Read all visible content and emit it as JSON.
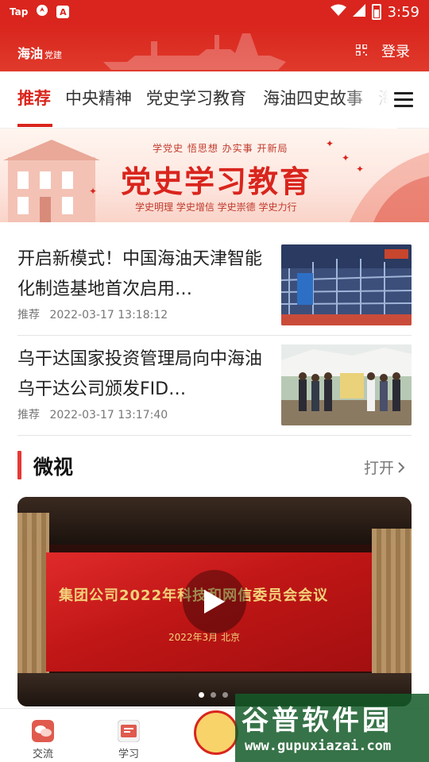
{
  "status_bar": {
    "app_label": "Tap",
    "time": "3:59",
    "icons": [
      "tap-app-icon",
      "navigation-icon",
      "text-icon",
      "wifi-icon",
      "signal-icon",
      "battery-icon"
    ]
  },
  "header": {
    "logo_text": "海油",
    "logo_sub": "党建",
    "login_label": "登录",
    "colors": {
      "primary": "#d9251d"
    }
  },
  "tabs": [
    {
      "label": "推荐",
      "active": true
    },
    {
      "label": "中央精神",
      "active": false
    },
    {
      "label": "党史学习教育",
      "active": false
    },
    {
      "label": "海油四史故事",
      "active": false
    },
    {
      "label": "海",
      "active": false
    }
  ],
  "banner": {
    "top_text": "学党史 悟思想 办实事 开新局",
    "title": "党史学习教育",
    "sub_text": "学史明理 学史增信 学史崇德 学史力行"
  },
  "news": [
    {
      "title": "开启新模式！中国海油天津智能化制造基地首次启用…",
      "tag": "推荐",
      "time": "2022-03-17 13:18:12"
    },
    {
      "title": "乌干达国家投资管理局向中海油乌干达公司颁发FID…",
      "tag": "推荐",
      "time": "2022-03-17 13:17:40"
    }
  ],
  "section": {
    "title": "微视",
    "more_label": "打开"
  },
  "video": {
    "screen_title": "集团公司2022年科技和网信委员会会议",
    "screen_date": "2022年3月 北京",
    "slide_count": 3,
    "active_slide": 1
  },
  "bottom_nav": [
    {
      "label": "交流",
      "icon": "chat-icon"
    },
    {
      "label": "学习",
      "icon": "study-icon"
    }
  ],
  "watermark": {
    "title": "谷普软件园",
    "url": "www.gupuxiazai.com"
  }
}
